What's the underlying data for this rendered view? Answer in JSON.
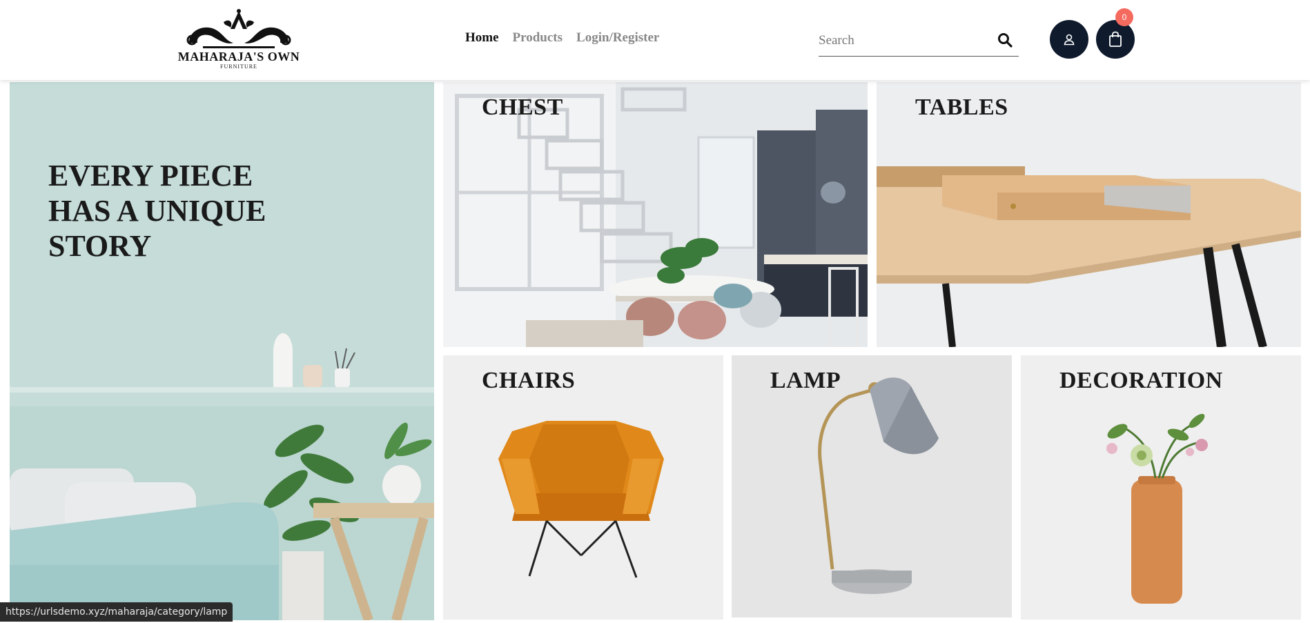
{
  "brand": {
    "name": "MAHARAJA'S OWN",
    "tagline": "FURNITURE"
  },
  "nav": {
    "items": [
      {
        "label": "Home",
        "active": true
      },
      {
        "label": "Products",
        "active": false
      },
      {
        "label": "Login/Register",
        "active": false
      }
    ]
  },
  "search": {
    "placeholder": "Search",
    "icon": "search-icon"
  },
  "actions": {
    "user_icon": "user-icon",
    "cart_icon": "shopping-bag-icon",
    "cart_count": "0"
  },
  "hero": {
    "headline_line1": "EVERY PIECE",
    "headline_line2": "HAS A UNIQUE",
    "headline_line3": "STORY"
  },
  "categories": [
    {
      "label": "CHEST"
    },
    {
      "label": "TABLES"
    },
    {
      "label": "CHAIRS"
    },
    {
      "label": "LAMP"
    },
    {
      "label": "DECORATION"
    }
  ],
  "status_bar": {
    "url": "https://urlsdemo.xyz/maharaja/category/lamp"
  },
  "colors": {
    "header_button_bg": "#0f1b2d",
    "cart_badge_bg": "#f46a5f",
    "hero_bg": "#bcd6d1"
  }
}
